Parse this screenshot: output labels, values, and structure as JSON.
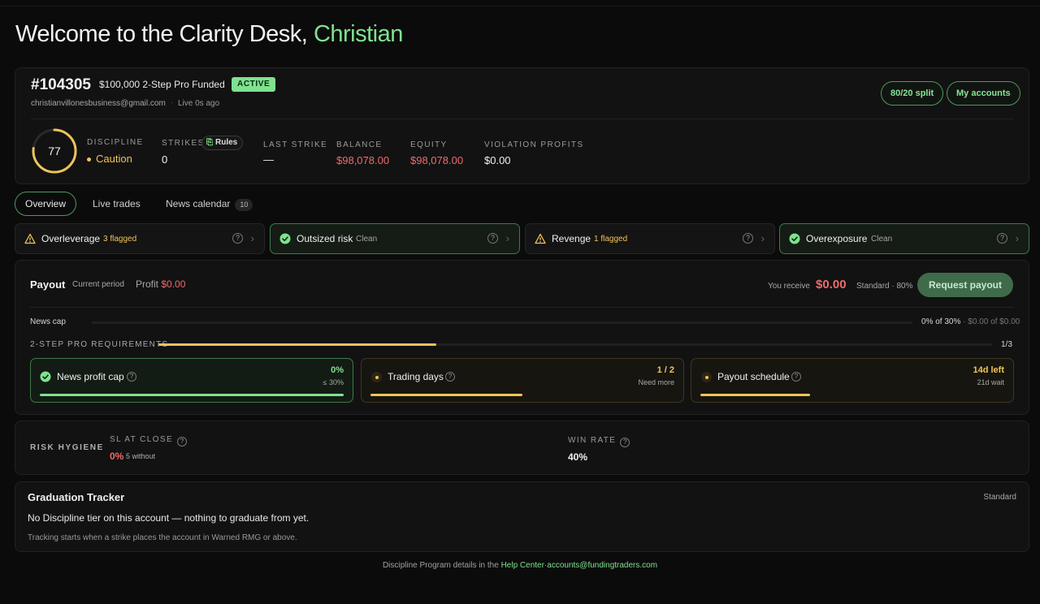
{
  "header": {
    "welcome_prefix": "Welcome to the Clarity Desk,",
    "user_name": "Christian"
  },
  "account": {
    "id": "#104305",
    "plan": "$100,000 2-Step Pro Funded",
    "status": "ACTIVE",
    "email": "christianvillonesbusiness@gmail.com",
    "separator": "·",
    "live": "Live 0s ago",
    "split_button": "80/20 split",
    "accounts_button": "My accounts"
  },
  "stats": {
    "discipline_score": 77,
    "discipline_fraction": 0.77,
    "discipline_label": "DISCIPLINE",
    "discipline_status": "Caution",
    "strikes_label": "STRIKES",
    "strikes_value": "0",
    "rules_label": "Rules",
    "last_strike_label": "LAST STRIKE",
    "last_strike_value": "—",
    "balance_label": "BALANCE",
    "balance_value": "$98,078.00",
    "equity_label": "EQUITY",
    "equity_value": "$98,078.00",
    "violation_label": "VIOLATION PROFITS",
    "violation_value": "$0.00"
  },
  "tabs": {
    "overview": "Overview",
    "live_trades": "Live trades",
    "news_calendar": "News calendar",
    "news_count": "10"
  },
  "checks": [
    {
      "title": "Overleverage",
      "status": "3 flagged",
      "state": "warn"
    },
    {
      "title": "Outsized risk",
      "status": "Clean",
      "state": "clean"
    },
    {
      "title": "Revenge",
      "status": "1 flagged",
      "state": "warn"
    },
    {
      "title": "Overexposure",
      "status": "Clean",
      "state": "clean"
    }
  ],
  "payout": {
    "title": "Payout",
    "period": "Current period",
    "profit_label": "Profit",
    "profit_value": "$0.00",
    "receive_label": "You receive",
    "receive_value": "$0.00",
    "standard": "Standard · 80%",
    "request_button": "Request payout",
    "news_cap_label": "News cap",
    "news_cap_value": "0% of 30%",
    "news_cap_detail": "· $0.00 of $0.00",
    "news_cap_fraction": 0,
    "req_label": "2-STEP PRO REQUIREMENTS",
    "req_value": "1/3",
    "req_fraction": 0.333,
    "requirements": [
      {
        "title": "News profit cap",
        "value": "0%",
        "sub": "≤ 30%",
        "state": "done",
        "fill": 1.0
      },
      {
        "title": "Trading days",
        "value": "1 / 2",
        "sub": "Need more",
        "state": "pending",
        "fill": 0.5
      },
      {
        "title": "Payout schedule",
        "value": "14d left",
        "sub": "21d wait",
        "state": "pending",
        "fill": 0.36
      }
    ]
  },
  "risk": {
    "label": "RISK HYGIENE",
    "sl_label": "SL AT CLOSE",
    "sl_value": "0%",
    "sl_sub": "5 without",
    "wr_label": "WIN RATE",
    "wr_value": "40%",
    "q": "?"
  },
  "graduation": {
    "title": "Graduation Tracker",
    "tier": "Standard",
    "message": "No Discipline tier on this account — nothing to graduate from yet.",
    "sub": "Tracking starts when a strike places the account in Warned RMG or above."
  },
  "footer": {
    "prefix": "Discipline Program details in the",
    "help_link": "Help Center",
    "sep": "·",
    "email": "accounts@fundingtraders.com"
  },
  "colors": {
    "accent_green": "#7ee28f",
    "warn_yellow": "#f0c35a",
    "negative_red": "#f16a6a"
  }
}
